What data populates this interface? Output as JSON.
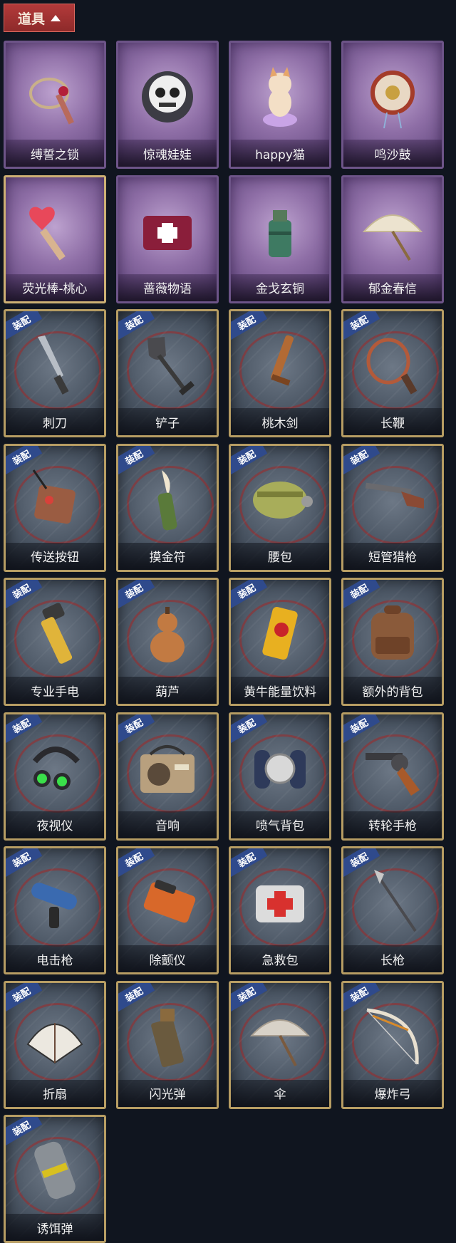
{
  "header": {
    "title": "道具"
  },
  "equip_badge_text": "装配",
  "items": [
    {
      "name": "缚誓之锁",
      "kind": "special",
      "icon": "chain-lock-icon"
    },
    {
      "name": "惊魂娃娃",
      "kind": "special",
      "icon": "skull-doll-icon"
    },
    {
      "name": "happy猫",
      "kind": "special",
      "icon": "cat-figure-icon"
    },
    {
      "name": "鸣沙鼓",
      "kind": "special",
      "icon": "sand-drum-icon"
    },
    {
      "name": "荧光棒-桃心",
      "kind": "special-gold",
      "icon": "heart-wand-icon"
    },
    {
      "name": "蔷薇物语",
      "kind": "special",
      "icon": "medkit-box-icon"
    },
    {
      "name": "金戈玄铜",
      "kind": "special",
      "icon": "bronze-grenade-icon"
    },
    {
      "name": "郁金春信",
      "kind": "special",
      "icon": "paper-umbrella-icon"
    },
    {
      "name": "刺刀",
      "kind": "equip",
      "icon": "bayonet-icon"
    },
    {
      "name": "铲子",
      "kind": "equip",
      "icon": "shovel-icon"
    },
    {
      "name": "桃木剑",
      "kind": "equip",
      "icon": "wooden-sword-icon"
    },
    {
      "name": "长鞭",
      "kind": "equip",
      "icon": "whip-icon"
    },
    {
      "name": "传送按钮",
      "kind": "equip",
      "icon": "teleport-remote-icon"
    },
    {
      "name": "摸金符",
      "kind": "equip",
      "icon": "talisman-icon"
    },
    {
      "name": "腰包",
      "kind": "equip",
      "icon": "waist-bag-icon"
    },
    {
      "name": "短管猎枪",
      "kind": "equip",
      "icon": "shotgun-icon"
    },
    {
      "name": "专业手电",
      "kind": "equip",
      "icon": "flashlight-icon"
    },
    {
      "name": "葫芦",
      "kind": "equip",
      "icon": "gourd-icon"
    },
    {
      "name": "黄牛能量饮料",
      "kind": "equip",
      "icon": "energy-drink-icon"
    },
    {
      "name": "额外的背包",
      "kind": "equip",
      "icon": "backpack-icon"
    },
    {
      "name": "夜视仪",
      "kind": "equip",
      "icon": "night-vision-icon"
    },
    {
      "name": "音响",
      "kind": "equip",
      "icon": "radio-speaker-icon"
    },
    {
      "name": "喷气背包",
      "kind": "equip",
      "icon": "jetpack-icon"
    },
    {
      "name": "转轮手枪",
      "kind": "equip",
      "icon": "revolver-icon"
    },
    {
      "name": "电击枪",
      "kind": "equip",
      "icon": "shock-gun-icon"
    },
    {
      "name": "除颤仪",
      "kind": "equip",
      "icon": "defibrillator-icon"
    },
    {
      "name": "急救包",
      "kind": "equip",
      "icon": "first-aid-kit-icon"
    },
    {
      "name": "长枪",
      "kind": "equip",
      "icon": "spear-icon"
    },
    {
      "name": "折扇",
      "kind": "equip",
      "icon": "folding-fan-icon"
    },
    {
      "name": "闪光弹",
      "kind": "equip",
      "icon": "flashbang-icon"
    },
    {
      "name": "伞",
      "kind": "equip",
      "icon": "umbrella-icon"
    },
    {
      "name": "爆炸弓",
      "kind": "equip",
      "icon": "explosive-bow-icon"
    },
    {
      "name": "诱饵弹",
      "kind": "equip",
      "icon": "decoy-canister-icon"
    }
  ]
}
